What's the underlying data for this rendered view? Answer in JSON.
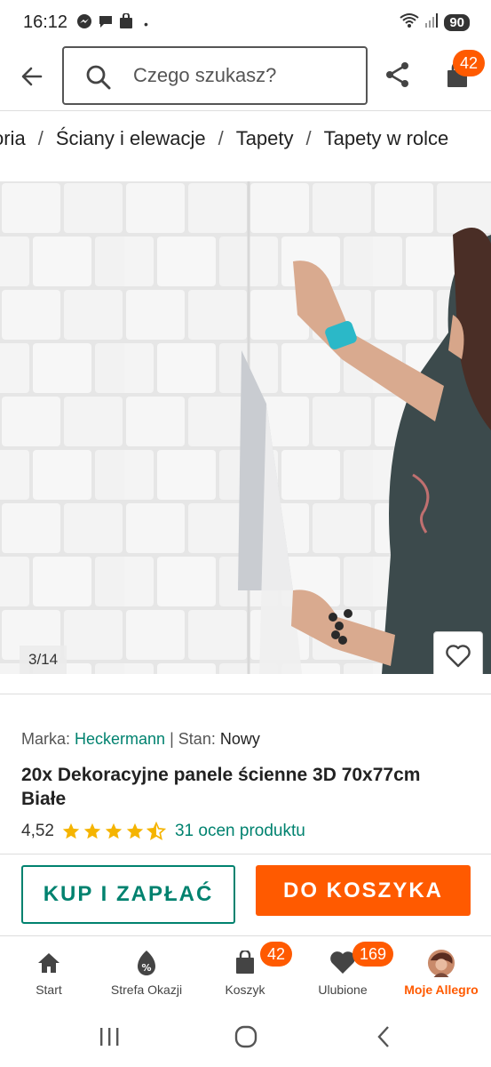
{
  "status_bar": {
    "time": "16:12",
    "dot": "•",
    "battery": "90",
    "left_icons": [
      "messenger-icon",
      "chat-icon",
      "shopping-bag-icon"
    ],
    "right_icons": [
      "wifi-icon",
      "signal-icon",
      "battery-icon"
    ]
  },
  "header": {
    "search_placeholder": "Czego szukasz?",
    "cart_count": "42"
  },
  "breadcrumb": {
    "items": [
      "oria",
      "Ściany i elewacje",
      "Tapety",
      "Tapety w rolce"
    ],
    "separator": "/"
  },
  "gallery": {
    "counter": "3/14"
  },
  "product": {
    "brand_label": "Marka:",
    "brand": "Heckermann",
    "meta_separator": "|",
    "condition_label": "Stan:",
    "condition": "Nowy",
    "title": "20x Dekoracyjne panele ścienne 3D 70x77cm Białe",
    "rating": "4,52",
    "rating_stars": 4.5,
    "ratings_link": "31 ocen produktu"
  },
  "actions": {
    "buy_now": "KUP I ZAPŁAĆ",
    "add_to_cart": "DO KOSZYKA"
  },
  "bottom_nav": {
    "items": [
      {
        "label": "Start",
        "icon": "home-icon"
      },
      {
        "label": "Strefa Okazji",
        "icon": "discount-icon"
      },
      {
        "label": "Koszyk",
        "icon": "cart-icon",
        "badge": "42"
      },
      {
        "label": "Ulubione",
        "icon": "heart-icon",
        "badge": "169"
      },
      {
        "label": "Moje Allegro",
        "icon": "avatar-icon",
        "active": true
      }
    ]
  },
  "colors": {
    "accent_orange": "#ff5a00",
    "accent_teal": "#00826f",
    "star_yellow": "#f5b400"
  }
}
